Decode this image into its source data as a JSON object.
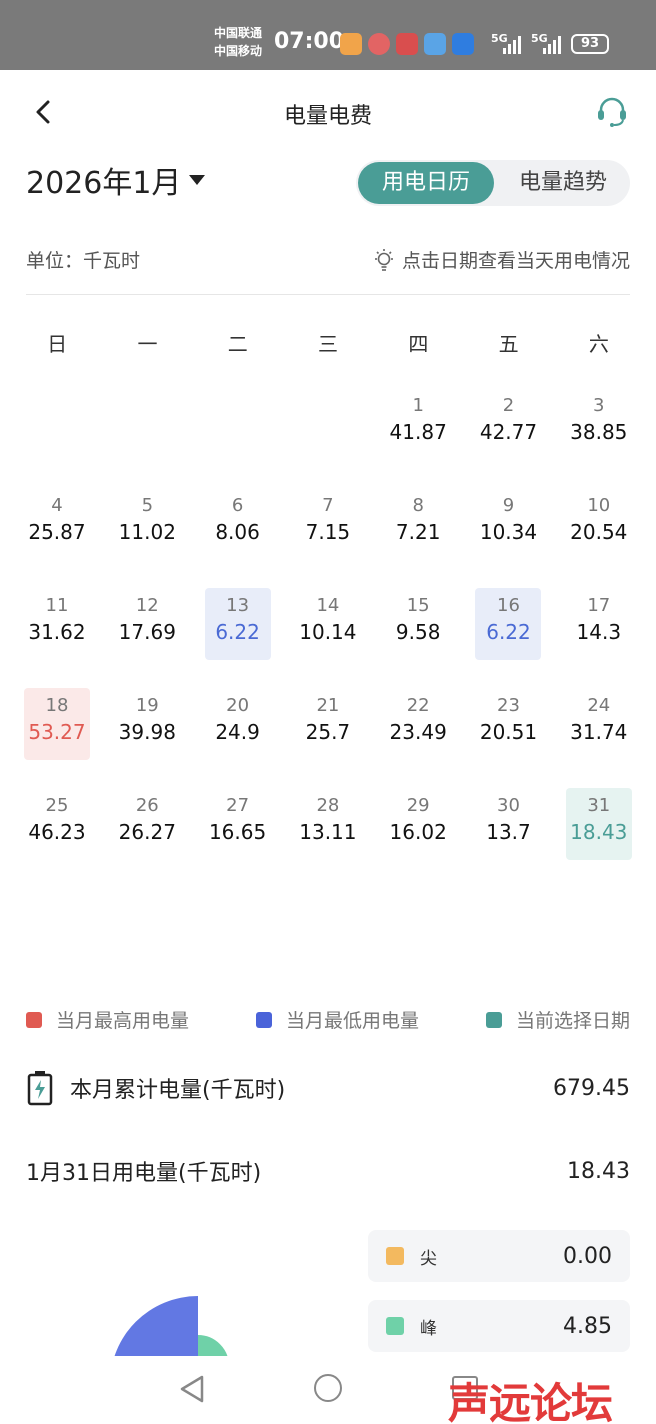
{
  "status_bar": {
    "carrier1": "中国联通",
    "carrier2": "中国移动",
    "time": "07:00",
    "net1": "5G",
    "net2": "5G",
    "battery": "93"
  },
  "header": {
    "title": "电量电费"
  },
  "month": "2026年1月",
  "tabs": [
    {
      "label": "用电日历",
      "active": true
    },
    {
      "label": "电量趋势",
      "active": false
    }
  ],
  "unit_label": "单位：千瓦时",
  "hint": "点击日期查看当天用电情况",
  "weekdays": [
    "日",
    "一",
    "二",
    "三",
    "四",
    "五",
    "六"
  ],
  "calendar": {
    "leading_blanks": 4,
    "days": [
      {
        "day": "1",
        "kwh": "41.87"
      },
      {
        "day": "2",
        "kwh": "42.77"
      },
      {
        "day": "3",
        "kwh": "38.85"
      },
      {
        "day": "4",
        "kwh": "25.87"
      },
      {
        "day": "5",
        "kwh": "11.02"
      },
      {
        "day": "6",
        "kwh": "8.06"
      },
      {
        "day": "7",
        "kwh": "7.15"
      },
      {
        "day": "8",
        "kwh": "7.21"
      },
      {
        "day": "9",
        "kwh": "10.34"
      },
      {
        "day": "10",
        "kwh": "20.54"
      },
      {
        "day": "11",
        "kwh": "31.62"
      },
      {
        "day": "12",
        "kwh": "17.69"
      },
      {
        "day": "13",
        "kwh": "6.22",
        "state": "low"
      },
      {
        "day": "14",
        "kwh": "10.14"
      },
      {
        "day": "15",
        "kwh": "9.58"
      },
      {
        "day": "16",
        "kwh": "6.22",
        "state": "low"
      },
      {
        "day": "17",
        "kwh": "14.3"
      },
      {
        "day": "18",
        "kwh": "53.27",
        "state": "high"
      },
      {
        "day": "19",
        "kwh": "39.98"
      },
      {
        "day": "20",
        "kwh": "24.9"
      },
      {
        "day": "21",
        "kwh": "25.7"
      },
      {
        "day": "22",
        "kwh": "23.49"
      },
      {
        "day": "23",
        "kwh": "20.51"
      },
      {
        "day": "24",
        "kwh": "31.74"
      },
      {
        "day": "25",
        "kwh": "46.23"
      },
      {
        "day": "26",
        "kwh": "26.27"
      },
      {
        "day": "27",
        "kwh": "16.65"
      },
      {
        "day": "28",
        "kwh": "13.11"
      },
      {
        "day": "29",
        "kwh": "16.02"
      },
      {
        "day": "30",
        "kwh": "13.7"
      },
      {
        "day": "31",
        "kwh": "18.43",
        "state": "sel"
      }
    ]
  },
  "legend": [
    {
      "label": "当月最高用电量",
      "color": "#e05a52"
    },
    {
      "label": "当月最低用电量",
      "color": "#4a63d9"
    },
    {
      "label": "当前选择日期",
      "color": "#4a9d96"
    }
  ],
  "summary": {
    "month_total_label": "本月累计电量(千瓦时)",
    "month_total_value": "679.45",
    "day_label": "1月31日用电量(千瓦时)",
    "day_value": "18.43"
  },
  "periods": [
    {
      "label": "尖",
      "value": "0.00",
      "color": "#f3b95f"
    },
    {
      "label": "峰",
      "value": "4.85",
      "color": "#6fd1a8"
    }
  ],
  "watermark": "声远论坛",
  "colors": {
    "accent": "#4a9d96",
    "high": "#e05a52",
    "low": "#4a63d9"
  }
}
